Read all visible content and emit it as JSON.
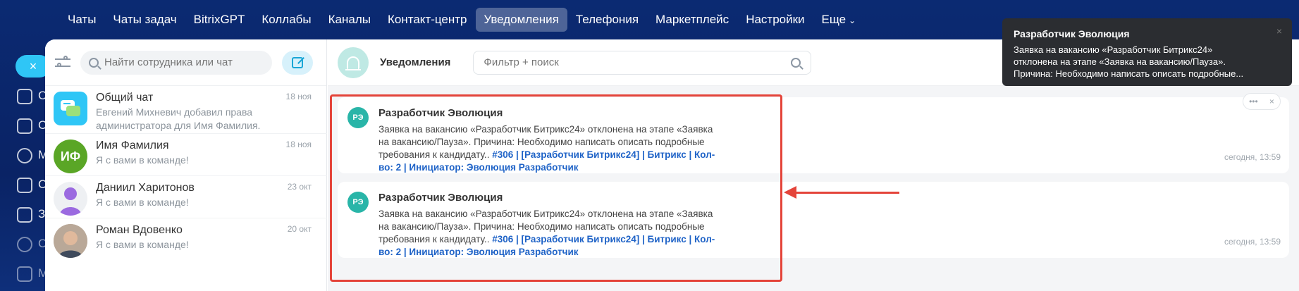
{
  "topnav": {
    "items": [
      "Чаты",
      "Чаты задач",
      "BitrixGPT",
      "Коллабы",
      "Каналы",
      "Контакт-центр",
      "Уведомления",
      "Телефония",
      "Маркетплейс",
      "Настройки",
      "Еще"
    ],
    "active_index": 6,
    "more_chevron": "⌄"
  },
  "rail": {
    "close_glyph": "×",
    "letters": [
      "С",
      "С",
      "М",
      "С",
      "З",
      "С",
      "М"
    ]
  },
  "chatlist": {
    "search_placeholder": "Найти сотрудника или чат",
    "items": [
      {
        "name": "Общий чат",
        "date": "18 ноя",
        "preview": "Евгений Михневич добавил права администратора для Имя Фамилия.",
        "avatar_text": "",
        "avatar_color": "#2fc6f6"
      },
      {
        "name": "Имя Фамилия",
        "date": "18 ноя",
        "preview": "Я с вами в команде!",
        "avatar_text": "ИФ",
        "avatar_color": "#5aa626"
      },
      {
        "name": "Даниил Харитонов",
        "date": "23 окт",
        "preview": "Я с вами в команде!",
        "avatar_text": "",
        "avatar_color": "#eceff2"
      },
      {
        "name": "Роман Вдовенко",
        "date": "20 окт",
        "preview": "Я с вами в команде!",
        "avatar_text": "",
        "avatar_color": "#8a8a88"
      }
    ]
  },
  "notifications": {
    "title": "Уведомления",
    "search_placeholder": "Фильтр + поиск",
    "cards": [
      {
        "avatar_text": "РЭ",
        "title": "Разработчик Эволюция",
        "text": "Заявка на вакансию «Разработчик Битрикс24» отклонена на этапе «Заявка на вакансию/Пауза». Причина: Необходимо написать описать подробные требования к кандидату.. ",
        "link": "#306 | [Разработчик Битрикс24] | Битрикс | Кол-во: 2 | Инициатор: Эволюция Разработчик",
        "time": "сегодня, 13:59"
      },
      {
        "avatar_text": "РЭ",
        "title": "Разработчик Эволюция",
        "text": "Заявка на вакансию «Разработчик Битрикс24» отклонена на этапе «Заявка на вакансию/Пауза». Причина: Необходимо написать описать подробные требования к кандидату.. ",
        "link": "#306 | [Разработчик Битрикс24] | Битрикс | Кол-во: 2 | Инициатор: Эволюция Разработчик",
        "time": "сегодня, 13:59"
      }
    ],
    "card_actions": {
      "more": "•••",
      "close": "×"
    }
  },
  "toast": {
    "title": "Разработчик Эволюция",
    "line1": "Заявка на вакансию «Разработчик Битрикс24»",
    "line2": "отклонена на этапе «Заявка на вакансию/Пауза».",
    "line3": "Причина: Необходимо написать описать подробные...",
    "close": "×"
  },
  "colors": {
    "accent": "#2fc6f6",
    "highlight": "#e4443a",
    "link": "#1f63c7"
  }
}
